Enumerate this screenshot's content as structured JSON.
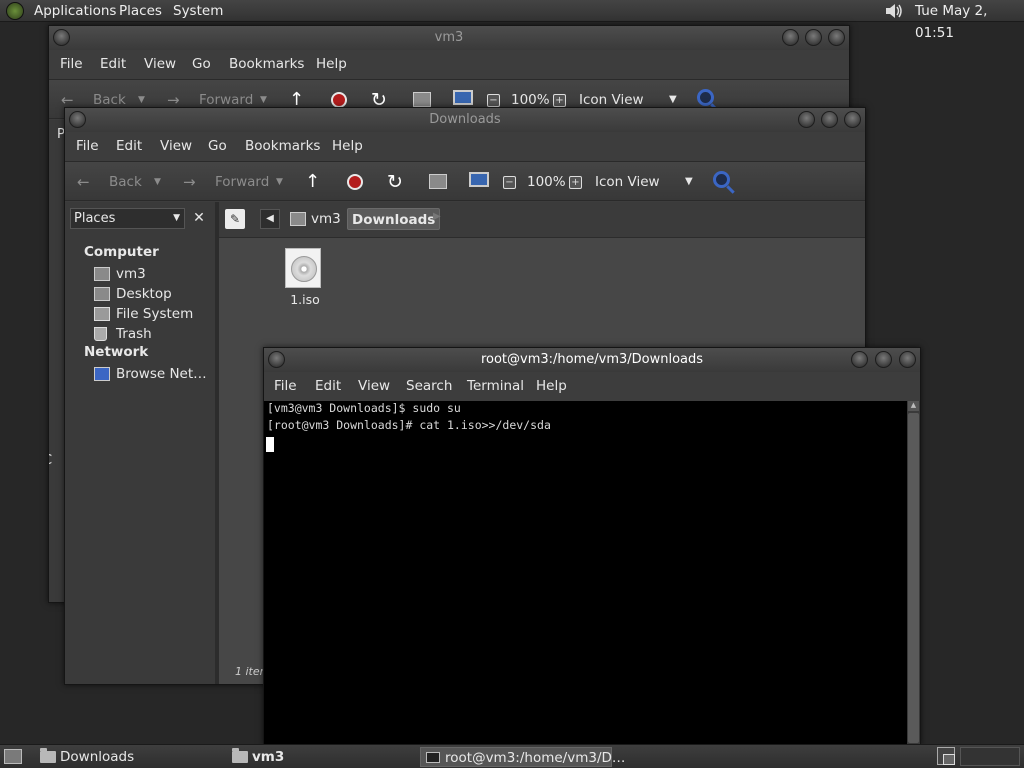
{
  "top_panel": {
    "menus": [
      "Applications",
      "Places",
      "System"
    ],
    "clock": "Tue May  2, 01:51"
  },
  "window_vm3": {
    "title": "vm3",
    "menus": [
      "File",
      "Edit",
      "View",
      "Go",
      "Bookmarks",
      "Help"
    ],
    "toolbar": {
      "back": "Back",
      "forward": "Forward",
      "zoom": "100%",
      "view_mode": "Icon View"
    },
    "partial_sidebar_char": "P",
    "partial_left_char": "C"
  },
  "window_downloads": {
    "title": "Downloads",
    "menus": [
      "File",
      "Edit",
      "View",
      "Go",
      "Bookmarks",
      "Help"
    ],
    "toolbar": {
      "back": "Back",
      "forward": "Forward",
      "zoom": "100%",
      "view_mode": "Icon View"
    },
    "sidebar": {
      "selector": "Places",
      "sections": [
        {
          "title": "Computer",
          "items": [
            "vm3",
            "Desktop",
            "File System",
            "Trash"
          ]
        },
        {
          "title": "Network",
          "items": [
            "Browse Net…"
          ]
        }
      ]
    },
    "path": [
      "vm3",
      "Downloads"
    ],
    "files": [
      {
        "name": "1.iso",
        "icon": "disc-image-icon"
      }
    ],
    "status": "1 item"
  },
  "terminal": {
    "title": "root@vm3:/home/vm3/Downloads",
    "menus": [
      "File",
      "Edit",
      "View",
      "Search",
      "Terminal",
      "Help"
    ],
    "lines": [
      "[vm3@vm3 Downloads]$ sudo su",
      "[root@vm3 Downloads]# cat 1.iso>>/dev/sda"
    ]
  },
  "bottom_panel": {
    "tasks": [
      "Downloads",
      "vm3",
      "root@vm3:/home/vm3/D…"
    ]
  }
}
